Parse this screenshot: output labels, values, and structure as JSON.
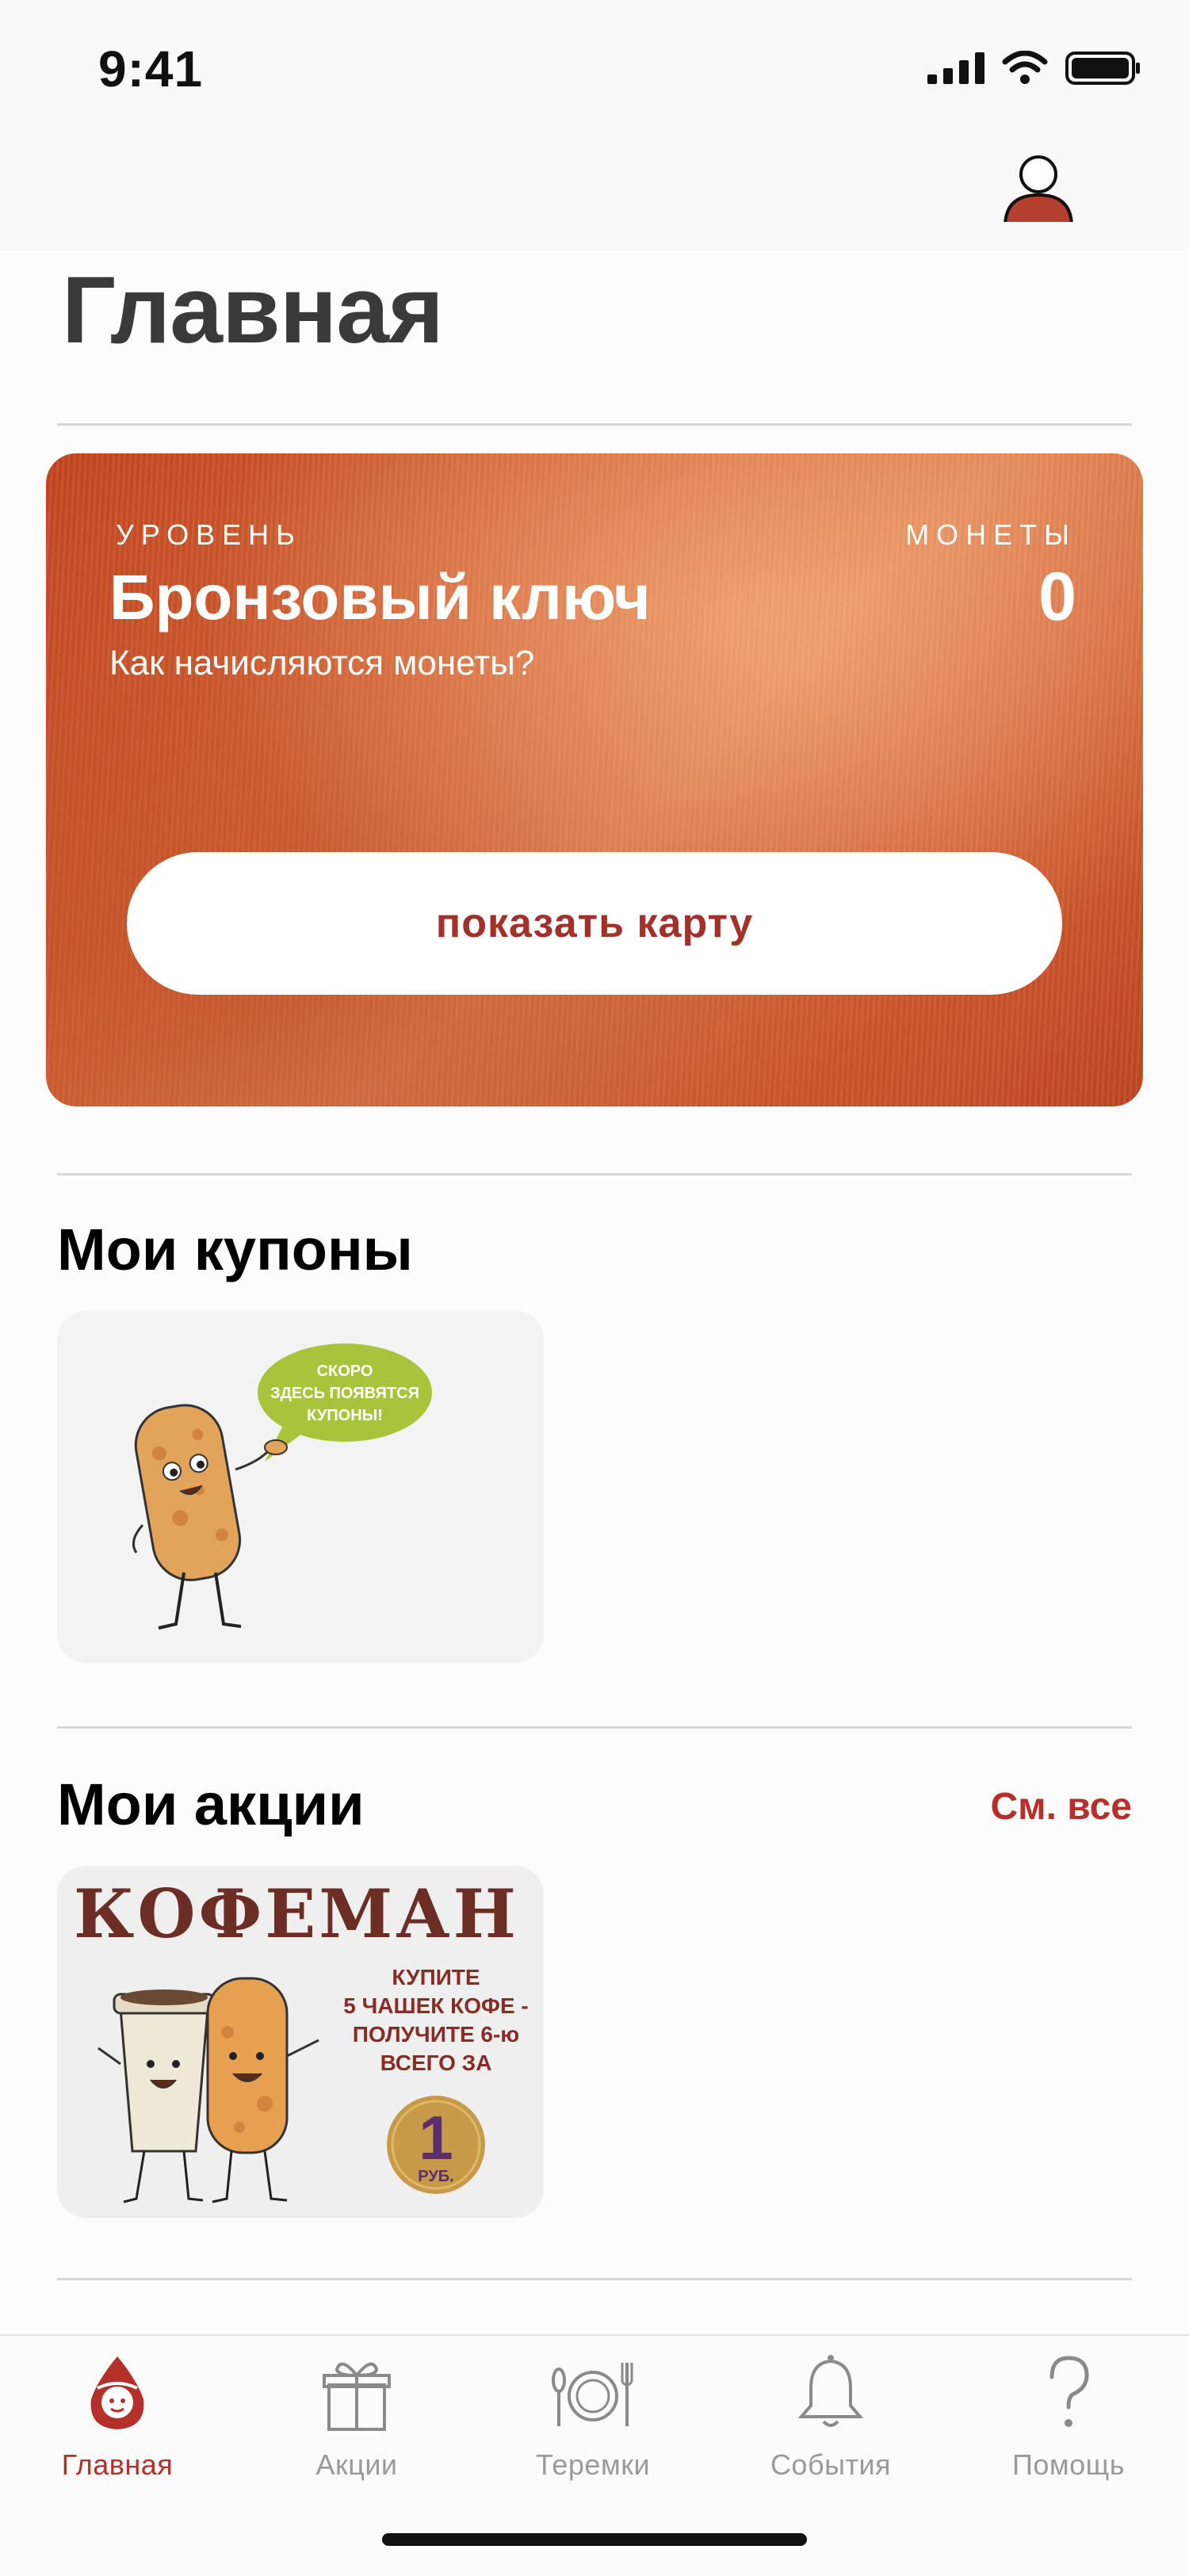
{
  "status_bar": {
    "time": "9:41"
  },
  "header": {
    "title": "Главная",
    "profile_icon": "person-icon"
  },
  "loyalty_card": {
    "level_caption": "УРОВЕНЬ",
    "level_name": "Бронзовый ключ",
    "coins_info_link": "Как начисляются монеты?",
    "coins_caption": "МОНЕТЫ",
    "coins_value": "0",
    "show_card_button": "показать карту"
  },
  "coupons": {
    "title": "Мои купоны",
    "placeholder_bubble": [
      "СКОРО",
      "ЗДЕСЬ ПОЯВЯТСЯ",
      "КУПОНЫ!"
    ]
  },
  "promos": {
    "title": "Мои акции",
    "see_all": "См. все",
    "items": [
      {
        "name": "КОФЕМАН",
        "text_lines": [
          "КУПИТЕ",
          "5 ЧАШЕК КОФЕ -",
          "ПОЛУЧИТЕ 6-ю",
          "ВСЕГО ЗА"
        ],
        "price_value": "1",
        "price_unit": "РУБ."
      }
    ]
  },
  "tab_bar": {
    "items": [
      {
        "label": "Главная",
        "icon": "teremok-home-icon",
        "active": true
      },
      {
        "label": "Акции",
        "icon": "gift-icon",
        "active": false
      },
      {
        "label": "Теремки",
        "icon": "plate-cutlery-icon",
        "active": false
      },
      {
        "label": "События",
        "icon": "bell-icon",
        "active": false
      },
      {
        "label": "Помощь",
        "icon": "question-icon",
        "active": false
      }
    ]
  },
  "colors": {
    "accent": "#b5302a",
    "card_bronze": "#d05a2d",
    "coupon_bubble": "#a9c43a"
  }
}
